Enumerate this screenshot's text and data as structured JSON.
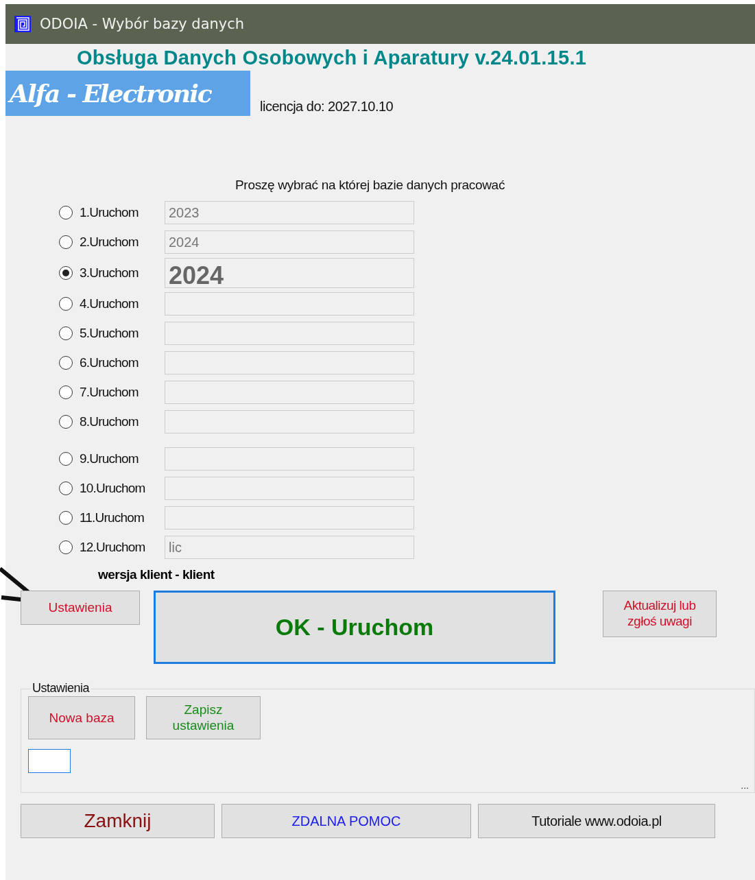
{
  "window": {
    "title": "ODOIA - Wybór bazy danych"
  },
  "app_title": "Obsługa Danych Osobowych i Aparatury  v.24.01.15.1",
  "logo_text": "Alfa - Electronic",
  "license": "licencja do: 2027.10.10",
  "prompt": "Proszę wybrać na której bazie danych pracować",
  "databases": [
    {
      "label": "1.Uruchom",
      "value": "2023",
      "selected": false
    },
    {
      "label": "2.Uruchom",
      "value": "2024",
      "selected": false
    },
    {
      "label": "3.Uruchom",
      "value": "2024",
      "selected": true
    },
    {
      "label": "4.Uruchom",
      "selected": false
    },
    {
      "label": "5.Uruchom",
      "selected": false
    },
    {
      "label": "6.Uruchom",
      "selected": false
    },
    {
      "label": "7.Uruchom",
      "selected": false
    },
    {
      "label": "8.Uruchom",
      "selected": false
    },
    {
      "label": "9.Uruchom",
      "selected": false
    },
    {
      "label": "10.Uruchom",
      "selected": false
    },
    {
      "label": "11.Uruchom",
      "selected": false
    },
    {
      "label": "12.Uruchom",
      "value": "lic",
      "selected": false
    }
  ],
  "version": "wersja klient - klient",
  "settings_button": "Ustawienia",
  "ok_button": "OK - Uruchom",
  "update_button": "Aktualizuj lub zgłoś uwagi",
  "settings_group": {
    "legend": "Ustawienia",
    "new_db_button": "Nowa baza",
    "save_button": "Zapisz ustawienia",
    "more": "..."
  },
  "footer_buttons": [
    {
      "label": "Zamknij",
      "kind": "close"
    },
    {
      "label": "ZDALNA POMOC",
      "kind": "help"
    },
    {
      "label": "Tutoriale www.odoia.pl",
      "kind": "link"
    }
  ]
}
